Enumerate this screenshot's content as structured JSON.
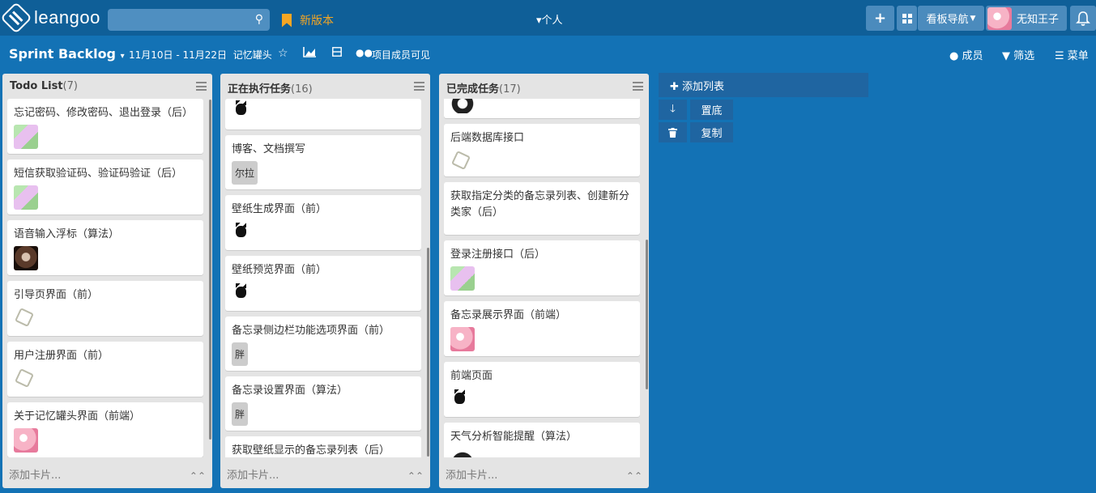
{
  "topbar": {
    "logo_text": "leangoo",
    "search_placeholder": "",
    "new_version_label": "新版本",
    "personal_label": "▾个人",
    "add_label": "+",
    "board_nav_label": "看板导航",
    "username": "无知王子"
  },
  "subbar": {
    "board_title": "Sprint Backlog",
    "date_range": "11月10日 - 11月22日",
    "project_name": "记忆罐头",
    "visibility_label": "项目成员可见",
    "members_label": "成员",
    "filter_label": "筛选",
    "menu_label": "菜单"
  },
  "lists": [
    {
      "title": "Todo List",
      "count": "(7)",
      "add_card_label": "添加卡片...",
      "cards": [
        {
          "text": "忘记密码、修改密码、退出登录（后）",
          "avatar": "anime-avatar"
        },
        {
          "text": "短信获取验证码、验证码验证（后）",
          "avatar": "anime-avatar"
        },
        {
          "text": "语音输入浮标（算法）",
          "avatar": "dark-avatar"
        },
        {
          "text": "引导页界面（前）",
          "avatar": "sketch-avatar"
        },
        {
          "text": "用户注册界面（前）",
          "avatar": "sketch-avatar"
        },
        {
          "text": "关于记忆罐头界面（前端）",
          "avatar": "pink-avatar"
        }
      ]
    },
    {
      "title": "正在执行任务",
      "count": "(16)",
      "add_card_label": "添加卡片...",
      "cards": [
        {
          "text": "",
          "avatar": "cat-avatar"
        },
        {
          "text": "博客、文档撰写",
          "tag": "尔拉"
        },
        {
          "text": "壁纸生成界面（前）",
          "avatar": "cat-avatar"
        },
        {
          "text": "壁纸预览界面（前）",
          "avatar": "cat-avatar"
        },
        {
          "text": "备忘录侧边栏功能选项界面（前）",
          "tag": "胖"
        },
        {
          "text": "备忘录设置界面（算法）",
          "tag": "胖"
        },
        {
          "text": "获取壁纸显示的备忘录列表（后）"
        }
      ]
    },
    {
      "title": "已完成任务",
      "count": "(17)",
      "add_card_label": "添加卡片...",
      "cards": [
        {
          "text": "",
          "avatar": "hair-avatar"
        },
        {
          "text": "后端数据库接口",
          "avatar": "sketch-avatar"
        },
        {
          "text": "获取指定分类的备忘录列表、创建新分类家（后）"
        },
        {
          "text": "登录注册接口（后）",
          "avatar": "anime-avatar"
        },
        {
          "text": "备忘录展示界面（前端）",
          "avatar": "pink-avatar"
        },
        {
          "text": "前端页面",
          "avatar": "cat-avatar"
        },
        {
          "text": "天气分析智能提醒（算法）",
          "avatar": "hair-avatar"
        }
      ]
    }
  ],
  "add_list": {
    "label": "添加列表",
    "to_bottom_label": "置底",
    "copy_label": "复制"
  },
  "icons": {
    "search": "search-icon",
    "bookmark": "bookmark-icon",
    "star": "star-icon",
    "chart": "chart-icon",
    "columns": "columns-icon",
    "users": "users-icon",
    "bell": "bell-icon"
  }
}
